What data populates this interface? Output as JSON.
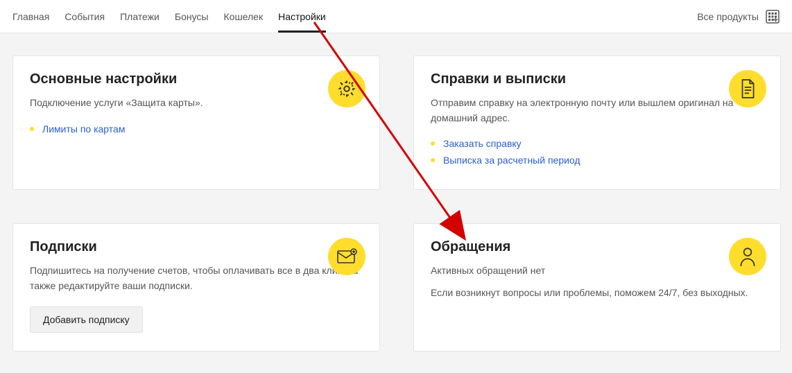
{
  "nav": {
    "tabs": [
      "Главная",
      "События",
      "Платежи",
      "Бонусы",
      "Кошелек",
      "Настройки"
    ],
    "active_index": 5,
    "all_products": "Все продукты"
  },
  "cards": {
    "main_settings": {
      "title": "Основные настройки",
      "desc": "Подключение услуги «Защита карты».",
      "link1": "Лимиты по картам"
    },
    "statements": {
      "title": "Справки и выписки",
      "desc": "Отправим справку на электронную почту или вышлем оригинал на домашний адрес.",
      "link1": "Заказать справку",
      "link2": "Выписка за расчетный период"
    },
    "subscriptions": {
      "title": "Подписки",
      "desc": "Подпишитесь на получение счетов, чтобы оплачивать все в два клика, а также редактируйте ваши подписки.",
      "button": "Добавить подписку"
    },
    "appeals": {
      "title": "Обращения",
      "status": "Активных обращений нет",
      "desc": "Если возникнут вопросы или проблемы, поможем 24/7, без выходных."
    }
  },
  "colors": {
    "accent": "#ffdd2d",
    "link": "#2a5fce"
  }
}
